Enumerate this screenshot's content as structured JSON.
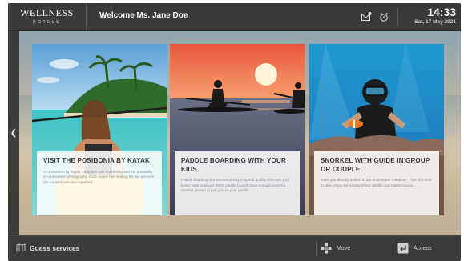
{
  "header": {
    "logo_main": "WELLNESS",
    "logo_sub": "HOTELS",
    "welcome": "Welcome Ms. Jane Doe",
    "icons": [
      "mail-icon",
      "alarm-clock-icon"
    ],
    "time": "14:33",
    "date": "Sat, 17 May 2021"
  },
  "cards": [
    {
      "title": "VISIT THE POSIDONIA BY KAYAK",
      "description": "An excursion by kayak, complete with snorkeling and the possibility of underwater photography. Each kayak has seating for two persons (for couples who live together)"
    },
    {
      "title": "PADDLE BOARDING WITH YOUR KIDS",
      "description": "Paddle boarding is a wonderful way to spend quality time with your loved ones outdoors. Most paddle boards have enough room for another person to join you on your paddle."
    },
    {
      "title": "SNORKEL WITH GUIDE IN GROUP OR COUPLE",
      "description": "Have you already sailed on our underwater meadow? Then it is time to dive, enjoy the variety of our wildlife and marine fauna."
    }
  ],
  "footer": {
    "guess_label": "Guess services",
    "move_label": "Move",
    "access_label": "Access"
  }
}
